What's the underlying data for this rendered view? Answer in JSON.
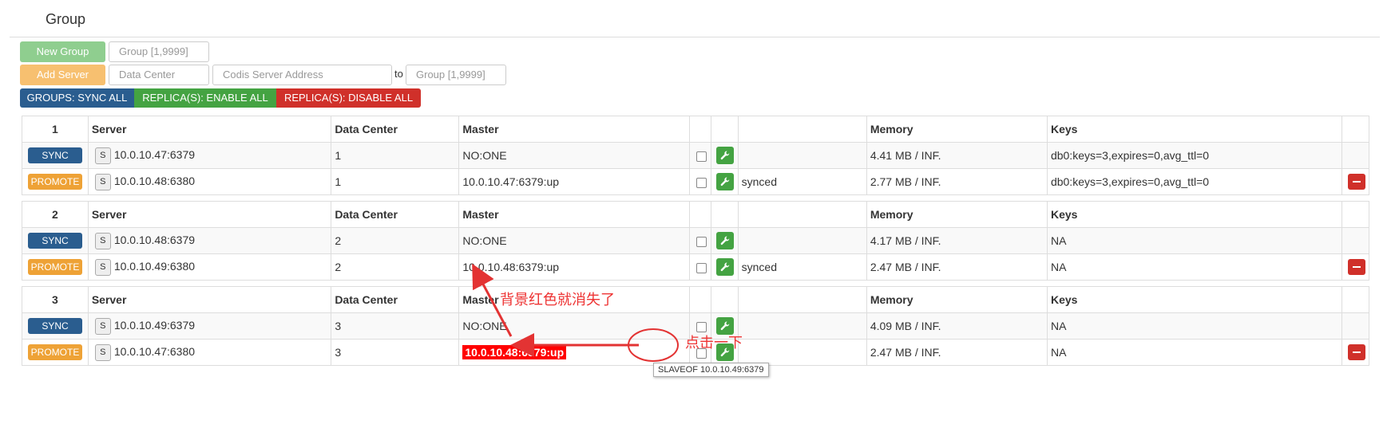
{
  "page": {
    "title": "Group"
  },
  "colors": {
    "primary": "#2a5d8f",
    "success": "#44a342",
    "danger": "#d0302a",
    "warning": "#eea236",
    "success_light": "#8fce8f",
    "warning_light": "#f7c070",
    "annotation": "#e33333"
  },
  "controls": {
    "new_group_label": "New Group",
    "group_placeholder": "Group [1,9999]",
    "add_server_label": "Add Server",
    "data_center_placeholder": "Data Center",
    "server_address_placeholder": "Codis Server Address",
    "to_label": "to",
    "target_group_placeholder": "Group [1,9999]",
    "groups_sync_all": "GROUPS: SYNC ALL",
    "replica_enable_all": "REPLICA(S): ENABLE ALL",
    "replica_disable_all": "REPLICA(S): DISABLE ALL"
  },
  "columns": {
    "server": "Server",
    "data_center": "Data Center",
    "master": "Master",
    "memory": "Memory",
    "keys": "Keys"
  },
  "groups": [
    {
      "id": "1",
      "rows": [
        {
          "action": "SYNC",
          "s": "S",
          "server": "10.0.10.47:6379",
          "dc": "1",
          "master": "NO:ONE",
          "status": "",
          "memory": "4.41 MB / INF.",
          "keys": "db0:keys=3,expires=0,avg_ttl=0"
        },
        {
          "action": "PROMOTE",
          "s": "S",
          "server": "10.0.10.48:6380",
          "dc": "1",
          "master": "10.0.10.47:6379:up",
          "status": "synced",
          "memory": "2.77 MB / INF.",
          "keys": "db0:keys=3,expires=0,avg_ttl=0"
        }
      ]
    },
    {
      "id": "2",
      "rows": [
        {
          "action": "SYNC",
          "s": "S",
          "server": "10.0.10.48:6379",
          "dc": "2",
          "master": "NO:ONE",
          "status": "",
          "memory": "4.17 MB / INF.",
          "keys": "NA"
        },
        {
          "action": "PROMOTE",
          "s": "S",
          "server": "10.0.10.49:6380",
          "dc": "2",
          "master": "10.0.10.48:6379:up",
          "status": "synced",
          "memory": "2.47 MB / INF.",
          "keys": "NA"
        }
      ]
    },
    {
      "id": "3",
      "rows": [
        {
          "action": "SYNC",
          "s": "S",
          "server": "10.0.10.49:6379",
          "dc": "3",
          "master": "NO:ONE",
          "status": "",
          "memory": "4.09 MB / INF.",
          "keys": "NA"
        },
        {
          "action": "PROMOTE",
          "s": "S",
          "server": "10.0.10.47:6380",
          "dc": "3",
          "master": "10.0.10.48:6379:up",
          "status": "",
          "memory": "2.47 MB / INF.",
          "keys": "NA"
        }
      ]
    }
  ],
  "annotations": {
    "red_gone": "背景红色就消失了",
    "click_once": "点击一下"
  },
  "tooltip": "SLAVEOF 10.0.10.49:6379"
}
